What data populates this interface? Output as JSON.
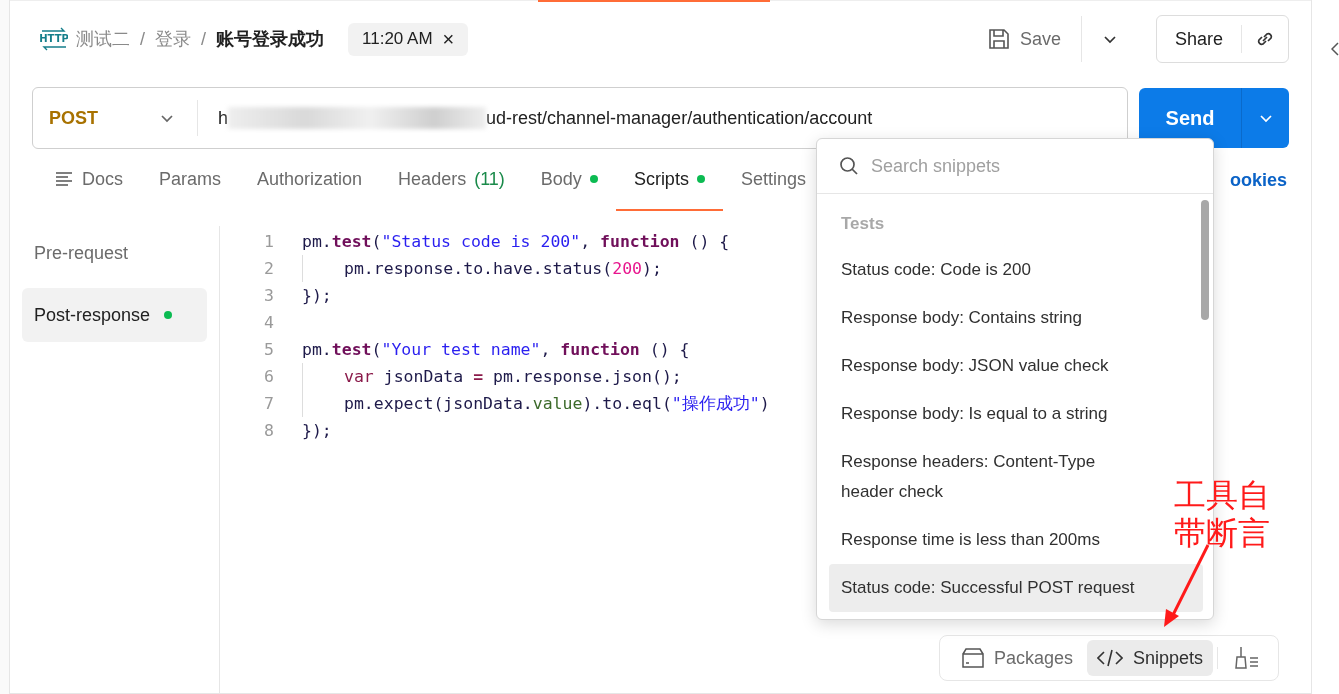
{
  "breadcrumb": {
    "badge": "HTTP",
    "items": [
      {
        "label": "测试二",
        "current": false
      },
      {
        "label": "登录",
        "current": false
      },
      {
        "label": "账号登录成功",
        "current": true
      }
    ],
    "separator": "/"
  },
  "time_chip": {
    "label": "11:20 AM",
    "close": "×"
  },
  "actions": {
    "save": "Save",
    "share": "Share"
  },
  "request": {
    "method": "POST",
    "url_start": "h",
    "url_visible": "ud-rest/channel-manager/authentication/account",
    "redacted": true,
    "send": "Send"
  },
  "tabs": [
    {
      "label": "Docs",
      "kind": "icon",
      "selected": false
    },
    {
      "label": "Params",
      "kind": "plain",
      "selected": false
    },
    {
      "label": "Authorization",
      "kind": "plain",
      "selected": false
    },
    {
      "label": "Headers",
      "count": "(11)",
      "kind": "count",
      "selected": false
    },
    {
      "label": "Body",
      "kind": "dot",
      "selected": false
    },
    {
      "label": "Scripts",
      "kind": "dot",
      "selected": true
    },
    {
      "label": "Settings",
      "kind": "plain",
      "selected": false
    }
  ],
  "cookies": "ookies",
  "script_tabs": [
    {
      "label": "Pre-request",
      "selected": false,
      "has_script": false
    },
    {
      "label": "Post-response",
      "selected": true,
      "has_script": true
    }
  ],
  "code": [
    {
      "number": "1",
      "indent": false,
      "tokens": [
        {
          "t": "pm.",
          "kind": "plain"
        },
        {
          "t": "test",
          "kind": "method"
        },
        {
          "t": "(",
          "kind": "plain"
        },
        {
          "t": "\"Status code is 200\"",
          "kind": "string"
        },
        {
          "t": ", ",
          "kind": "plain"
        },
        {
          "t": "function",
          "kind": "keyword"
        },
        {
          "t": " () {",
          "kind": "plain"
        }
      ]
    },
    {
      "number": "2",
      "indent": true,
      "tokens": [
        {
          "t": "pm.response.to.have.status(",
          "kind": "plain"
        },
        {
          "t": "200",
          "kind": "number"
        },
        {
          "t": ");",
          "kind": "plain"
        }
      ]
    },
    {
      "number": "3",
      "indent": false,
      "tokens": [
        {
          "t": "});",
          "kind": "plain"
        }
      ]
    },
    {
      "number": "4",
      "indent": false
    },
    {
      "number": "5",
      "indent": false,
      "tokens": [
        {
          "t": "pm.",
          "kind": "plain"
        },
        {
          "t": "test",
          "kind": "method"
        },
        {
          "t": "(",
          "kind": "plain"
        },
        {
          "t": "\"Your test name\"",
          "kind": "string"
        },
        {
          "t": ", ",
          "kind": "plain"
        },
        {
          "t": "function",
          "kind": "keyword"
        },
        {
          "t": " () {",
          "kind": "plain"
        }
      ]
    },
    {
      "number": "6",
      "indent": true,
      "tokens": [
        {
          "t": "var",
          "kind": "var"
        },
        {
          "t": " jsonData ",
          "kind": "plain"
        },
        {
          "t": "=",
          "kind": "operator"
        },
        {
          "t": " pm.response.json();",
          "kind": "plain"
        }
      ]
    },
    {
      "number": "7",
      "indent": true,
      "tokens": [
        {
          "t": "pm.expect(jsonData.",
          "kind": "plain"
        },
        {
          "t": "value",
          "kind": "property"
        },
        {
          "t": ").to.eql(",
          "kind": "plain"
        },
        {
          "t": "\"操作成功\"",
          "kind": "string"
        },
        {
          "t": ")",
          "kind": "plain"
        }
      ]
    },
    {
      "number": "8",
      "indent": false,
      "tokens": [
        {
          "t": "});",
          "kind": "plain"
        }
      ]
    }
  ],
  "snippets": {
    "placeholder": "Search snippets",
    "section": "Tests",
    "items": [
      {
        "label": "Status code: Code is 200",
        "selected": false
      },
      {
        "label": "Response body: Contains string",
        "selected": false
      },
      {
        "label": "Response body: JSON value check",
        "selected": false
      },
      {
        "label": "Response body: Is equal to a string",
        "selected": false
      },
      {
        "label": "Response headers: Content-Type header check",
        "selected": false
      },
      {
        "label": "Response time is less than 200ms",
        "selected": false
      },
      {
        "label": "Status code: Successful POST request",
        "selected": true
      }
    ]
  },
  "toolbar": [
    {
      "label": "Packages",
      "kind": "packages",
      "selected": false
    },
    {
      "label": "Snippets",
      "kind": "snippets",
      "selected": true
    }
  ],
  "annotation": {
    "lines": [
      "工具自",
      "带断言"
    ]
  }
}
